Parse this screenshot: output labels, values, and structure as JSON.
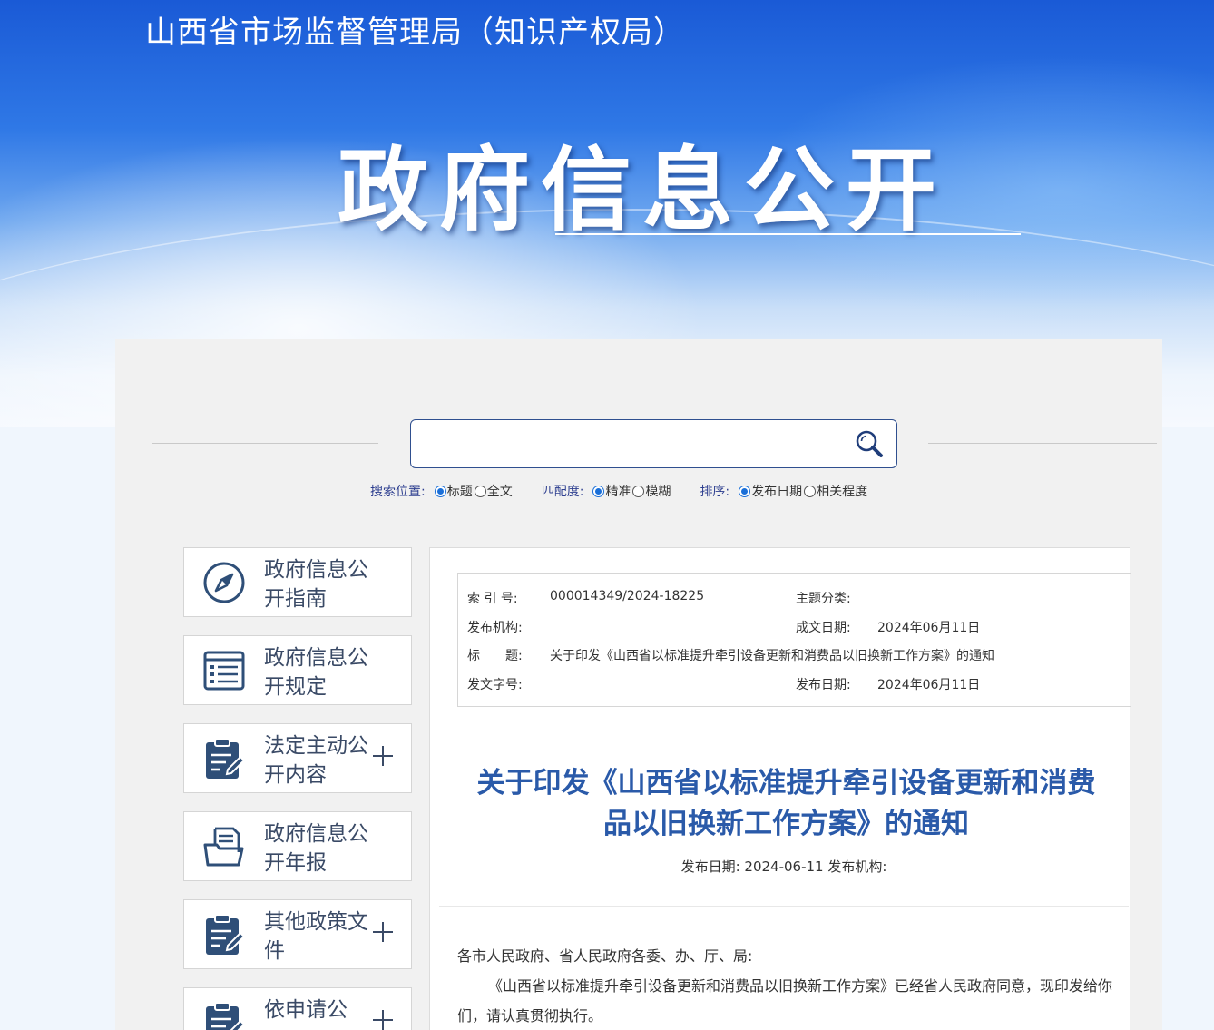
{
  "header": {
    "site_title": "山西省市场监督管理局（知识产权局）",
    "hero_title": "政府信息公开"
  },
  "search": {
    "placeholder": "",
    "value": "",
    "position": {
      "label": "搜索位置:",
      "options": [
        "标题",
        "全文"
      ],
      "selected": "标题"
    },
    "match": {
      "label": "匹配度:",
      "options": [
        "精准",
        "模糊"
      ],
      "selected": "精准"
    },
    "sort": {
      "label": "排序:",
      "options": [
        "发布日期",
        "相关程度"
      ],
      "selected": "发布日期"
    }
  },
  "sidebar": {
    "items": [
      {
        "label": "政府信息公开指南",
        "icon": "compass-icon",
        "expandable": false
      },
      {
        "label": "政府信息公开规定",
        "icon": "list-icon",
        "expandable": false
      },
      {
        "label": "法定主动公开内容",
        "icon": "clipboard-edit-icon",
        "expandable": true
      },
      {
        "label": "政府信息公开年报",
        "icon": "folder-doc-icon",
        "expandable": false
      },
      {
        "label": "其他政策文件",
        "icon": "clipboard-edit-icon",
        "expandable": true
      },
      {
        "label": "依申请公",
        "icon": "clipboard-edit-icon",
        "expandable": true
      }
    ]
  },
  "article": {
    "meta": {
      "index_no_label": "索 引 号:",
      "index_no": "000014349/2024-18225",
      "topic_label": "主题分类:",
      "topic": "",
      "publisher_label": "发布机构:",
      "publisher": "",
      "created_label": "成文日期:",
      "created": "2024年06月11日",
      "title_label": "标　　题:",
      "title": "关于印发《山西省以标准提升牵引设备更新和消费品以旧换新工作方案》的通知",
      "doc_no_label": "发文字号:",
      "doc_no": "",
      "published_label": "发布日期:",
      "published": "2024年06月11日"
    },
    "title_line1": "关于印发《山西省以标准提升牵引设备更新和消费",
    "title_line2": "品以旧换新工作方案》的通知",
    "date_line": "发布日期: 2024-06-11 发布机构:",
    "body": [
      "各市人民政府、省人民政府各委、办、厅、局:",
      "《山西省以标准提升牵引设备更新和消费品以旧换新工作方案》已经省人民政府同意，现印发给你们，请认真贯彻执行。"
    ]
  }
}
